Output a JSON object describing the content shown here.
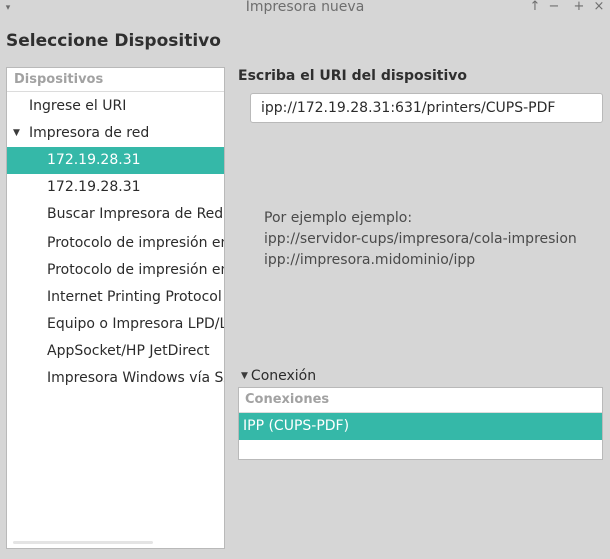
{
  "window": {
    "title": "Impresora nueva",
    "menu_glyph": "▾",
    "buttons": {
      "keep_above": "↑",
      "minimize": "−",
      "maximize": "+",
      "close": "×"
    }
  },
  "page_title": "Seleccione Dispositivo",
  "devices": {
    "header": "Dispositivos",
    "items": [
      {
        "label": "Ingrese el URI",
        "indent": 1,
        "selected": false
      },
      {
        "label": "Impresora de red",
        "indent": 1,
        "selected": false,
        "expanded": true,
        "arrow": "▼"
      },
      {
        "label": "172.19.28.31",
        "indent": 2,
        "selected": true
      },
      {
        "label": "172.19.28.31",
        "indent": 2,
        "selected": false
      },
      {
        "label": "Buscar Impresora de Red",
        "indent": 2,
        "selected": false
      },
      {
        "label": "Protocolo de impresión en",
        "indent": 2,
        "selected": false
      },
      {
        "label": "Protocolo de impresión en",
        "indent": 2,
        "selected": false
      },
      {
        "label": "Internet Printing Protocol",
        "indent": 2,
        "selected": false
      },
      {
        "label": "Equipo o Impresora LPD/L",
        "indent": 2,
        "selected": false
      },
      {
        "label": "AppSocket/HP JetDirect",
        "indent": 2,
        "selected": false
      },
      {
        "label": "Impresora Windows vía SA",
        "indent": 2,
        "selected": false
      }
    ]
  },
  "uri": {
    "label": "Escriba el URI del dispositivo",
    "value": "ipp://172.19.28.31:631/printers/CUPS-PDF"
  },
  "example": {
    "line1": "Por ejemplo ejemplo:",
    "line2": "ipp://servidor-cups/impresora/cola-impresion",
    "line3": "ipp://impresora.midominio/ipp"
  },
  "connection": {
    "expander_label": "Conexión",
    "arrow": "▼",
    "header": "Conexiones",
    "rows": [
      {
        "label": "IPP (CUPS-PDF)",
        "selected": true
      }
    ]
  },
  "colors": {
    "selection": "#35b8a8",
    "window_bg": "#d6d6d6",
    "panel_bg": "#ffffff",
    "header_text": "#a2a2a2"
  }
}
